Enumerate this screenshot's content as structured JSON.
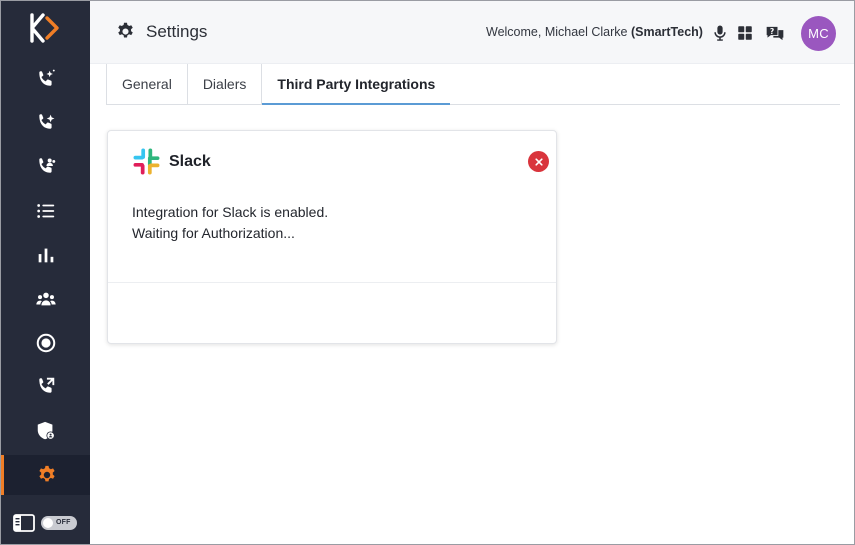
{
  "sidebar": {
    "logo": "K>",
    "items": [
      {
        "name": "phone-sparkle-icon"
      },
      {
        "name": "phone-sparkle-2-icon"
      },
      {
        "name": "phone-users-icon"
      },
      {
        "name": "list-icon"
      },
      {
        "name": "bar-chart-icon"
      },
      {
        "name": "users-icon"
      },
      {
        "name": "record-icon"
      },
      {
        "name": "phone-transfer-icon"
      },
      {
        "name": "shield-user-icon"
      },
      {
        "name": "gear-icon",
        "active": true
      }
    ],
    "toggle_label": "OFF"
  },
  "header": {
    "title": "Settings",
    "welcome_prefix": "Welcome, Michael Clarke",
    "company": "(SmartTech)",
    "avatar_initials": "MC"
  },
  "tabs": [
    {
      "label": "General"
    },
    {
      "label": "Dialers"
    },
    {
      "label": "Third Party Integrations",
      "active": true
    }
  ],
  "integration": {
    "name": "Slack",
    "line1": "Integration for Slack is enabled.",
    "line2": "Waiting for Authorization..."
  },
  "colors": {
    "sidebar_bg": "#262b3a",
    "accent_orange": "#f07e26",
    "tab_underline": "#5b9bd5",
    "avatar_bg": "#9a57bf",
    "remove_red": "#d9343c"
  }
}
